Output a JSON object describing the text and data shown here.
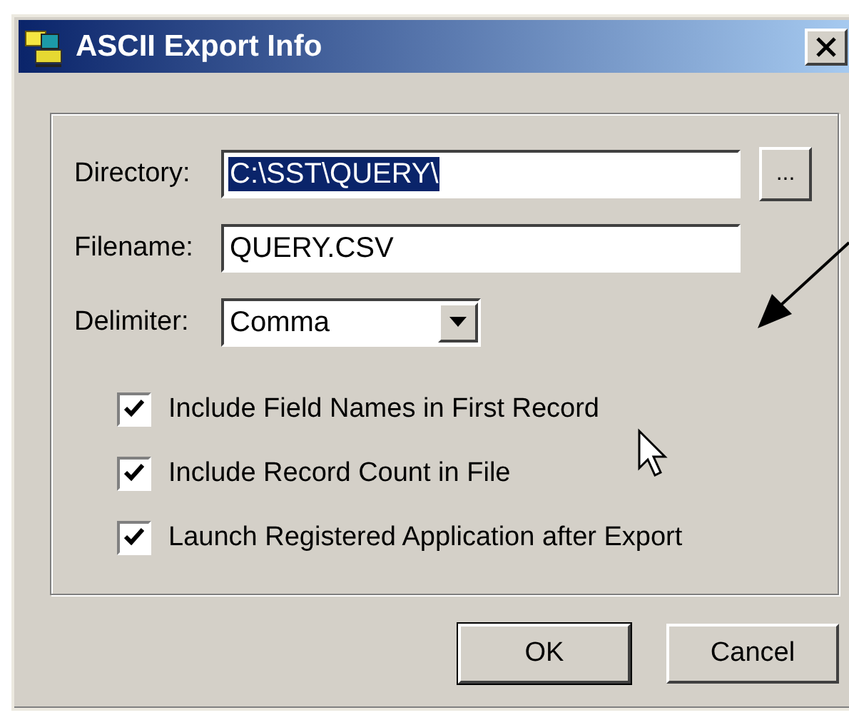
{
  "window": {
    "title": "ASCII Export Info"
  },
  "fields": [
    {
      "label": "Directory:",
      "value": "C:\\SST\\QUERY\\",
      "value_selected": true,
      "browse": "..."
    },
    {
      "label": "Filename:",
      "value": "QUERY.CSV",
      "value_selected": false
    }
  ],
  "delimiter": {
    "label": "Delimiter:",
    "value": "Comma"
  },
  "options": [
    {
      "label": "Include Field Names in First Record",
      "checked": true
    },
    {
      "label": "Include Record Count in File",
      "checked": true
    },
    {
      "label": "Launch Registered Application after Export",
      "checked": true
    }
  ],
  "buttons": [
    {
      "label": "OK",
      "default": true
    },
    {
      "label": "Cancel",
      "default": false
    }
  ]
}
